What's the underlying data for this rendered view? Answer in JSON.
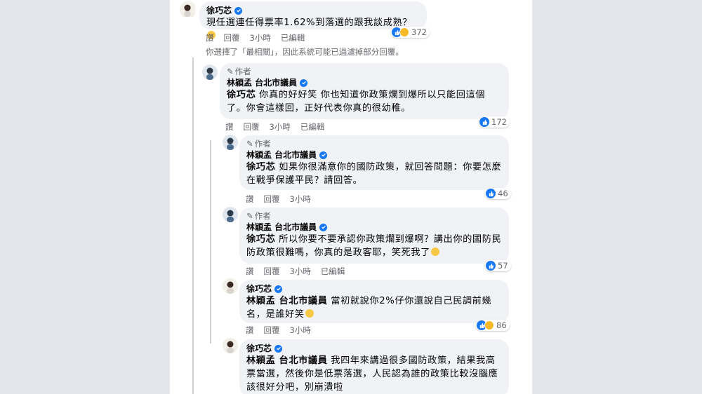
{
  "actions": {
    "like": "讚",
    "reply": "回覆",
    "edited": "已編輯"
  },
  "filter_note": "你選擇了「最相關」，因此系統可能已過濾掉部分回覆。",
  "comments": [
    {
      "author": "徐巧芯",
      "author_tag": "",
      "text": "現任選連任得票率1.62%到落選的跟我談成熟？",
      "time": "3小時",
      "edited": true,
      "reactions": [
        "like",
        "haha"
      ],
      "count": "372"
    },
    {
      "author_label": "作者",
      "author": "林穎孟 台北市議員",
      "mention": "徐巧芯",
      "text": " 你真的好好笑 你也知道你政策爛到爆所以只能回這個了。你會這樣回，正好代表你真的很幼稚。",
      "time": "3小時",
      "edited": true,
      "reactions": [
        "like"
      ],
      "count": "172"
    },
    {
      "author_label": "作者",
      "author": "林穎孟 台北市議員",
      "mention": "徐巧芯",
      "text": " 如果你很滿意你的國防政策，就回答問題：你要怎麼在戰爭保護平民？請回答。",
      "time": "3小時",
      "edited": false,
      "reactions": [
        "like"
      ],
      "count": "46"
    },
    {
      "author_label": "作者",
      "author": "林穎孟 台北市議員",
      "mention": "徐巧芯",
      "text": " 所以你要不要承認你政策爛到爆啊？講出你的國防民防政策很難嗎，你真的是政客耶，笑死我了",
      "time": "3小時",
      "edited": true,
      "reactions": [
        "like"
      ],
      "count": "57"
    },
    {
      "author": "徐巧芯",
      "mention": "林穎孟 台北市議員",
      "text": " 當初就說你2%仔你還說自己民調前幾名，是誰好笑",
      "time": "3小時",
      "edited": false,
      "reactions": [
        "like",
        "haha"
      ],
      "count": "86"
    },
    {
      "author": "徐巧芯",
      "mention": "林穎孟 台北市議員",
      "text": " 我四年來講過很多國防政策，結果我高票當選，然後你是低票落選，人民認為誰的政策比較沒腦應該很好分吧，別崩潰啦",
      "time": "",
      "edited": false,
      "reactions": [],
      "count": ""
    }
  ],
  "colors": {
    "page_bg": "#e4e6eb",
    "bubble": "#f0f2f5",
    "verified": "#1877f2",
    "meta": "#65676b"
  }
}
